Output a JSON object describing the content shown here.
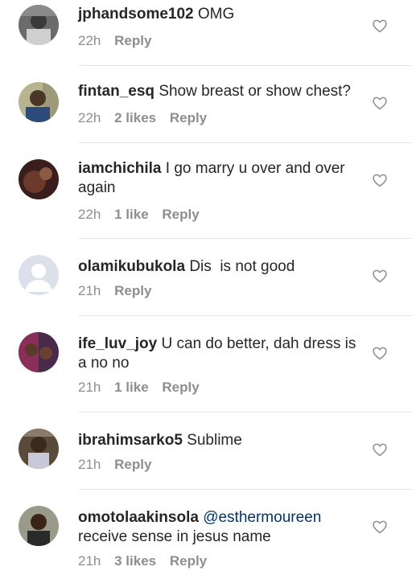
{
  "icons": {
    "like": "heart-outline-icon"
  },
  "comments": [
    {
      "username": "jphandsome102",
      "text": "OMG",
      "time": "22h",
      "likes": "",
      "reply": "Reply"
    },
    {
      "username": "fintan_esq",
      "text": "Show breast or show chest?",
      "time": "22h",
      "likes": "2 likes",
      "reply": "Reply"
    },
    {
      "username": "iamchichila",
      "text": "I go marry u over and over again",
      "time": "22h",
      "likes": "1 like",
      "reply": "Reply"
    },
    {
      "username": "olamikubukola",
      "text": "Dis  is not good",
      "time": "21h",
      "likes": "",
      "reply": "Reply"
    },
    {
      "username": "ife_luv_joy",
      "text": "U can do better, dah dress is a no no",
      "time": "21h",
      "likes": "1 like",
      "reply": "Reply"
    },
    {
      "username": "ibrahimsarko5",
      "text": "Sublime",
      "time": "21h",
      "likes": "",
      "reply": "Reply"
    },
    {
      "username": "omotolaakinsola",
      "mention": "@esthermoureen",
      "text": "receive sense in jesus name",
      "time": "21h",
      "likes": "3 likes",
      "reply": "Reply"
    }
  ]
}
